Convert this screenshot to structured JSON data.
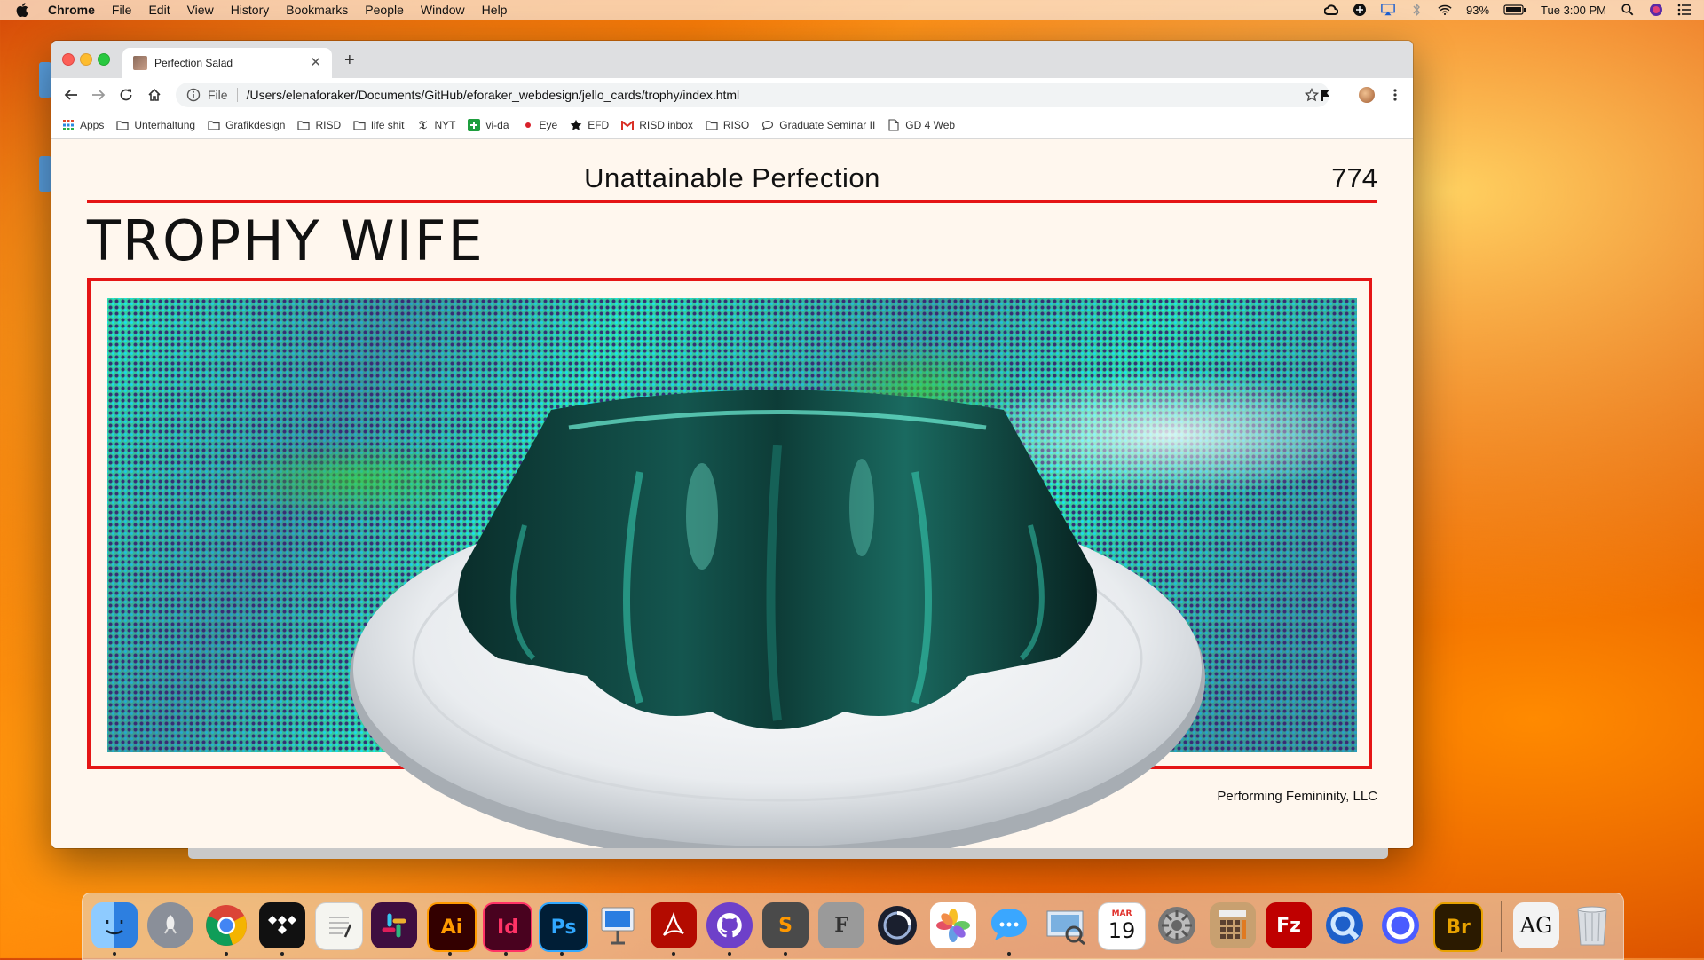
{
  "menubar": {
    "app_name": "Chrome",
    "items": [
      "File",
      "Edit",
      "View",
      "History",
      "Bookmarks",
      "People",
      "Window",
      "Help"
    ],
    "battery": "93%",
    "clock": "Tue 3:00 PM"
  },
  "browser": {
    "tab_title": "Perfection Salad",
    "scheme_label": "File",
    "url": "/Users/elenaforaker/Documents/GitHub/eforaker_webdesign/jello_cards/trophy/index.html",
    "bookmarks": [
      {
        "label": "Apps",
        "icon": "apps-grid-icon"
      },
      {
        "label": "Unterhaltung",
        "icon": "folder-icon"
      },
      {
        "label": "Grafikdesign",
        "icon": "folder-icon"
      },
      {
        "label": "RISD",
        "icon": "folder-icon"
      },
      {
        "label": "life shit",
        "icon": "folder-icon"
      },
      {
        "label": "NYT",
        "icon": "nyt-icon"
      },
      {
        "label": "vi-da",
        "icon": "plus-green-icon"
      },
      {
        "label": "Eye",
        "icon": "eye-dot-icon"
      },
      {
        "label": "EFD",
        "icon": "star-icon"
      },
      {
        "label": "RISD inbox",
        "icon": "gmail-icon"
      },
      {
        "label": "RISO",
        "icon": "folder-icon"
      },
      {
        "label": "Graduate Seminar II",
        "icon": "chat-bubble-icon"
      },
      {
        "label": "GD 4 Web",
        "icon": "page-icon"
      }
    ]
  },
  "card": {
    "kicker": "Unattainable Perfection",
    "number": "774",
    "title": "TROPHY WIFE",
    "footer": "Performing Femininity, LLC"
  },
  "dock": {
    "apps": [
      {
        "name": "Finder",
        "icon": "finder-icon",
        "color": "#2d7fe0"
      },
      {
        "name": "Launchpad",
        "icon": "rocket-icon",
        "color": "#8a8f99"
      },
      {
        "name": "Chrome",
        "icon": "chrome-icon",
        "color": "#e8e8e8"
      },
      {
        "name": "Tidal",
        "icon": "tidal-icon",
        "color": "#111111"
      },
      {
        "name": "TextEdit",
        "icon": "notes-icon",
        "color": "#f5f5f0"
      },
      {
        "name": "Slack",
        "icon": "slack-icon",
        "color": "#3f0e40"
      },
      {
        "name": "Illustrator",
        "icon": "illustrator-icon",
        "color": "#330000",
        "label": "Ai",
        "text_color": "#ff9a00"
      },
      {
        "name": "InDesign",
        "icon": "indesign-icon",
        "color": "#49021f",
        "label": "Id",
        "text_color": "#ff3366"
      },
      {
        "name": "Photoshop",
        "icon": "photoshop-icon",
        "color": "#001e36",
        "label": "Ps",
        "text_color": "#31a8ff"
      },
      {
        "name": "Keynote",
        "icon": "keynote-icon",
        "color": "#1e6fd9"
      },
      {
        "name": "Acrobat",
        "icon": "acrobat-icon",
        "color": "#b30b00"
      },
      {
        "name": "GitHub",
        "icon": "github-icon",
        "color": "#6e40c9"
      },
      {
        "name": "Sublime Text",
        "icon": "sublime-icon",
        "color": "#4a4a4a",
        "label": "S",
        "text_color": "#ff9800"
      },
      {
        "name": "Font Book",
        "icon": "fontbook-icon",
        "color": "#9a9a9a",
        "label": "F",
        "text_color": "#333333"
      },
      {
        "name": "Cinema 4D",
        "icon": "cinema4d-icon",
        "color": "#1a1f2e"
      },
      {
        "name": "Photos",
        "icon": "photos-icon",
        "color": "#ffffff"
      },
      {
        "name": "Messages",
        "icon": "messages-icon",
        "color": "#3aa7ff"
      },
      {
        "name": "Preview",
        "icon": "preview-icon",
        "color": "#7ab0e0"
      },
      {
        "name": "Calendar",
        "icon": "calendar-icon",
        "color": "#ffffff",
        "month": "MAR",
        "day": "19"
      },
      {
        "name": "System Preferences",
        "icon": "gear-icon",
        "color": "#777777"
      },
      {
        "name": "Calculator",
        "icon": "calculator-icon",
        "color": "#c8a070"
      },
      {
        "name": "FileZilla",
        "icon": "filezilla-icon",
        "color": "#bf0000",
        "label": "Fz",
        "text_color": "#ffffff"
      },
      {
        "name": "QuickTime",
        "icon": "quicktime-icon",
        "color": "#1e5fc9"
      },
      {
        "name": "Browser",
        "icon": "circle-app-icon",
        "color": "#4a5cff"
      },
      {
        "name": "Bridge",
        "icon": "bridge-icon",
        "color": "#2b1a00",
        "label": "Br",
        "text_color": "#e8a200"
      },
      {
        "name": "Font Viewer",
        "icon": "font-viewer-icon",
        "color": "#f3f3f3",
        "label": "AG",
        "text_color": "#111111"
      },
      {
        "name": "Trash",
        "icon": "trash-icon",
        "color": "#d9dde2"
      }
    ]
  },
  "colors": {
    "accent_red": "#e51515",
    "page_bg": "#fff7ee",
    "jello": "#0f4a44"
  }
}
